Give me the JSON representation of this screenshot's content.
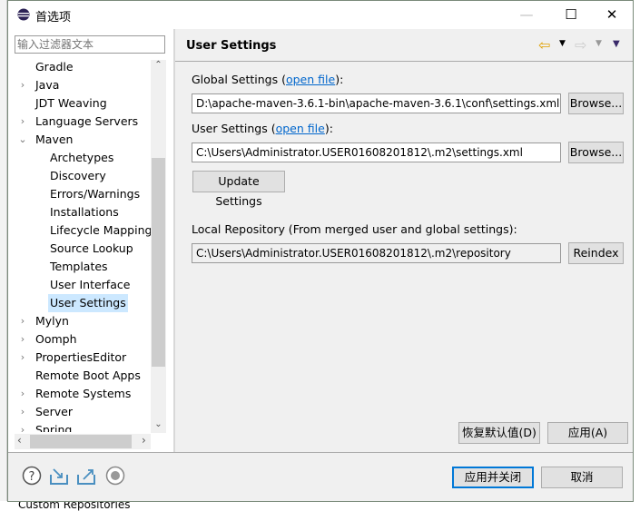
{
  "window": {
    "title": "首选项",
    "minimize": "—",
    "maximize": "☐",
    "close": "✕"
  },
  "filter": {
    "placeholder": "输入过滤器文本"
  },
  "tree": [
    {
      "label": "Gradle",
      "level": 0,
      "chevron": ""
    },
    {
      "label": "Java",
      "level": 0,
      "chevron": "›"
    },
    {
      "label": "JDT Weaving",
      "level": 0,
      "chevron": ""
    },
    {
      "label": "Language Servers",
      "level": 0,
      "chevron": "›"
    },
    {
      "label": "Maven",
      "level": 0,
      "chevron": "⌄"
    },
    {
      "label": "Archetypes",
      "level": 1,
      "chevron": ""
    },
    {
      "label": "Discovery",
      "level": 1,
      "chevron": ""
    },
    {
      "label": "Errors/Warnings",
      "level": 1,
      "chevron": ""
    },
    {
      "label": "Installations",
      "level": 1,
      "chevron": ""
    },
    {
      "label": "Lifecycle Mappings",
      "level": 1,
      "chevron": ""
    },
    {
      "label": "Source Lookup",
      "level": 1,
      "chevron": ""
    },
    {
      "label": "Templates",
      "level": 1,
      "chevron": ""
    },
    {
      "label": "User Interface",
      "level": 1,
      "chevron": ""
    },
    {
      "label": "User Settings",
      "level": 1,
      "chevron": "",
      "selected": true
    },
    {
      "label": "Mylyn",
      "level": 0,
      "chevron": "›"
    },
    {
      "label": "Oomph",
      "level": 0,
      "chevron": "›"
    },
    {
      "label": "PropertiesEditor",
      "level": 0,
      "chevron": "›"
    },
    {
      "label": "Remote Boot Apps",
      "level": 0,
      "chevron": ""
    },
    {
      "label": "Remote Systems",
      "level": 0,
      "chevron": "›"
    },
    {
      "label": "Server",
      "level": 0,
      "chevron": "›"
    },
    {
      "label": "Spring",
      "level": 0,
      "chevron": "›"
    }
  ],
  "page": {
    "title": "User Settings",
    "global_label": "Global Settings (",
    "open_file": "open file",
    "label_end": "):",
    "global_value": "D:\\apache-maven-3.6.1-bin\\apache-maven-3.6.1\\conf\\settings.xml",
    "browse": "Browse...",
    "user_label": "User Settings (",
    "user_value": "C:\\Users\\Administrator.USER01608201812\\.m2\\settings.xml",
    "update": "Update Settings",
    "local_label": "Local Repository (From merged user and global settings):",
    "local_value": "C:\\Users\\Administrator.USER01608201812\\.m2\\repository",
    "reindex": "Reindex",
    "restore": "恢复默认值(D)",
    "apply": "应用(A)"
  },
  "footer": {
    "apply_close": "应用并关闭",
    "cancel": "取消"
  },
  "background": {
    "behind_text": "Custom Repositories"
  },
  "colors": {
    "accent": "#0078d7",
    "link": "#0066cc",
    "selection": "#cce8ff"
  }
}
